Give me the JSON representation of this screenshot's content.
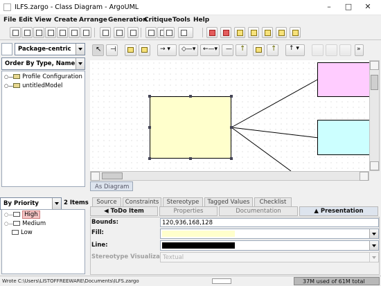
{
  "window": {
    "title": "ILFS.zargo - Class Diagram - ArgoUML"
  },
  "menu": [
    "File",
    "Edit",
    "View",
    "Create",
    "Arrange",
    "Generation",
    "Critique",
    "Tools",
    "Help"
  ],
  "explorer": {
    "perspective": "Package-centric",
    "order": "Order By Type, Name",
    "items": [
      "Profile Configuration",
      "untitledModel"
    ]
  },
  "todo": {
    "group_by": "By Priority",
    "count": "2 Items",
    "items": [
      "High",
      "Medium",
      "Low"
    ]
  },
  "diagram": {
    "tab": "As Diagram",
    "colors": {
      "node_yellow": "#ffffcc",
      "node_pink": "#ffccff",
      "node_cyan": "#ccffff"
    }
  },
  "details": {
    "tabs_top": [
      "Source",
      "Constraints",
      "Stereotype",
      "Tagged Values",
      "Checklist"
    ],
    "tabs_bottom": [
      "◀ ToDo Item",
      "Properties",
      "Documentation",
      "▲ Presentation"
    ],
    "bounds_label": "Bounds:",
    "bounds_value": "120,936,168,128",
    "fill_label": "Fill:",
    "line_label": "Line:",
    "stereo_label": "Stereotype Visualization:",
    "stereo_value": "Textual"
  },
  "status": {
    "message": "Wrote C:\\Users\\LISTOFFREEWARE\\Documents\\ILFS.zargo",
    "memory": "37M used of 61M total"
  }
}
